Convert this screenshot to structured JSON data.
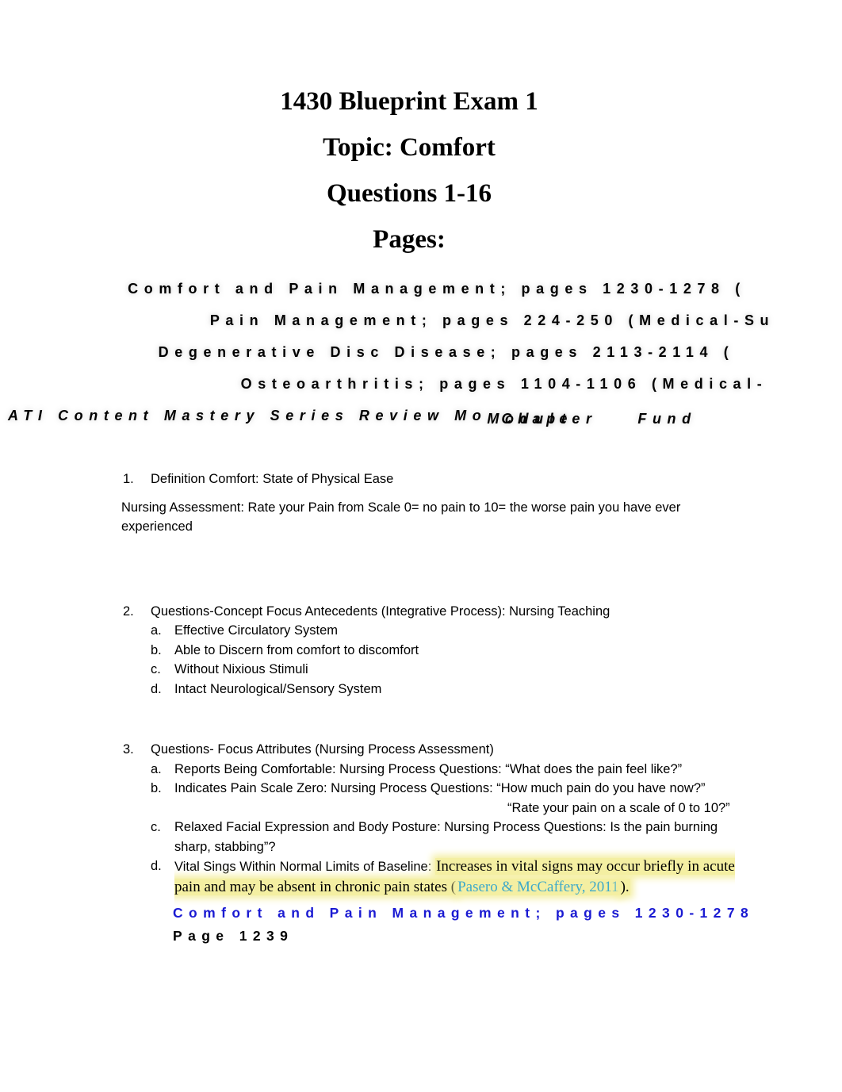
{
  "document": {
    "titles": [
      "1430 Blueprint Exam 1",
      "Topic: Comfort",
      "Questions 1-16",
      "Pages:"
    ],
    "reference_lines": [
      "Comfort and Pain Management; pages 1230-1278 (",
      "Pain Management; pages 224-250 (Medical-Su",
      "Degenerative Disc Disease; pages 2113-2114 (",
      "Osteoarthritis; pages 1104-1106 (Medical-"
    ],
    "reference_italic": {
      "base": "ATI Content Mastery Series Review Mo",
      "overlap_1": "Module",
      "overlap_2": "Chapter",
      "overlap_3": "Fund"
    }
  },
  "items": {
    "item1": {
      "marker": "1.",
      "text": "Definition Comfort: State of Physical Ease",
      "paragraph": "Nursing Assessment: Rate your Pain from Scale 0= no pain to 10= the worse pain you have ever experienced"
    },
    "item2": {
      "marker": "2.",
      "text": "Questions-Concept Focus Antecedents (Integrative Process): Nursing Teaching",
      "subitems": [
        {
          "marker": "a.",
          "text": "Effective Circulatory System"
        },
        {
          "marker": "b.",
          "text": "Able to Discern from comfort to discomfort"
        },
        {
          "marker": "c.",
          "text": "Without Nixious Stimuli"
        },
        {
          "marker": "d.",
          "text": "Intact Neurological/Sensory System"
        }
      ]
    },
    "item3": {
      "marker": "3.",
      "text": "Questions- Focus Attributes (Nursing Process Assessment)",
      "sub_a": {
        "marker": "a.",
        "text": "Reports Being Comfortable: Nursing Process Questions: “What does the pain feel like?”"
      },
      "sub_b": {
        "marker": "b.",
        "text": "Indicates Pain Scale Zero: Nursing Process Questions: “How much pain do you have now?”"
      },
      "sub_b_continuation": "“Rate your pain on a scale of 0 to 10?”",
      "sub_c": {
        "marker": "c.",
        "text": "Relaxed Facial Expression and Body Posture: Nursing Process Questions: Is the pain burning sharp, stabbing”?"
      },
      "sub_d": {
        "marker": "d.",
        "lead": "Vital Sings Within Normal Limits of Baseline:",
        "highlight_1": "Increases in vital signs may occur briefly in acute pain and may be absent in chronic pain states (",
        "citation": "Pasero & McCaffery, 2011",
        "highlight_2": ")."
      }
    }
  },
  "footer": {
    "reference": "Comfort and Pain Management; pages 1230-1278",
    "page_label": "Page 1239"
  },
  "colors": {
    "highlight": "#f4efa2",
    "citation": "#3fa9c9",
    "footer_reference": "#1a1ad2",
    "text": "#000000"
  }
}
